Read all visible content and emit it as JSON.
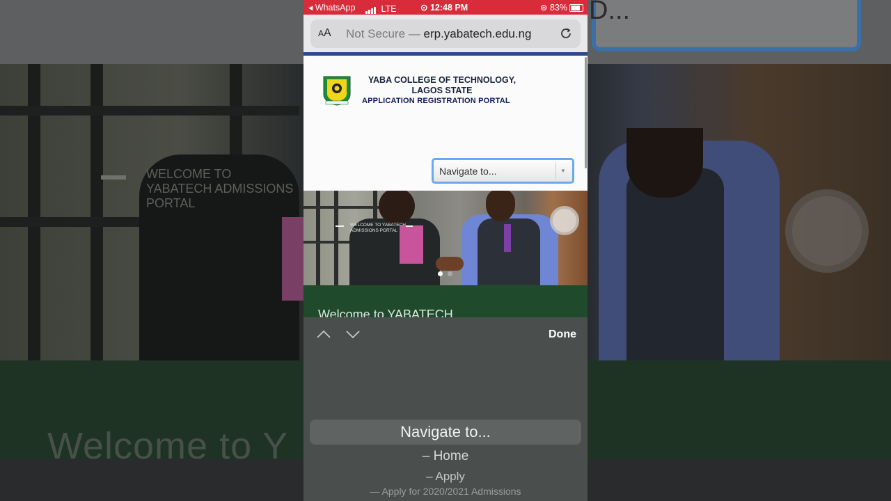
{
  "background": {
    "blurred_url_fragment": "D...",
    "blurred_welcome": "Welcome to Y",
    "blurred_hero_caption": "WELCOME TO\nYABATECH ADMISSIONS\nPORTAL"
  },
  "status_bar": {
    "back_app": "◂ WhatsApp",
    "network": "LTE",
    "time": "12:48 PM",
    "battery": "83%"
  },
  "browser": {
    "text_size_label": "AA",
    "security": "Not Secure —",
    "domain": "erp.yabatech.edu.ng"
  },
  "header": {
    "college_line1": "YABA COLLEGE OF TECHNOLOGY,",
    "college_line2": "LAGOS STATE",
    "portal_name": "APPLICATION REGISTRATION PORTAL"
  },
  "nav_select": {
    "selected": "Navigate to..."
  },
  "hero": {
    "caption": "WELCOME TO YABATECH ADMISSIONS PORTAL"
  },
  "welcome_heading": "Welcome to YABATECH",
  "picker": {
    "done_label": "Done",
    "options": [
      "Navigate to...",
      "– Home",
      "– Apply",
      "— Apply for 2020/2021 Admissions"
    ]
  },
  "colors": {
    "status_bar": "#d92c3b",
    "focus_ring": "#6aa9f0",
    "green_band": "#1f4b2c",
    "portal_text": "#0f1b55"
  }
}
